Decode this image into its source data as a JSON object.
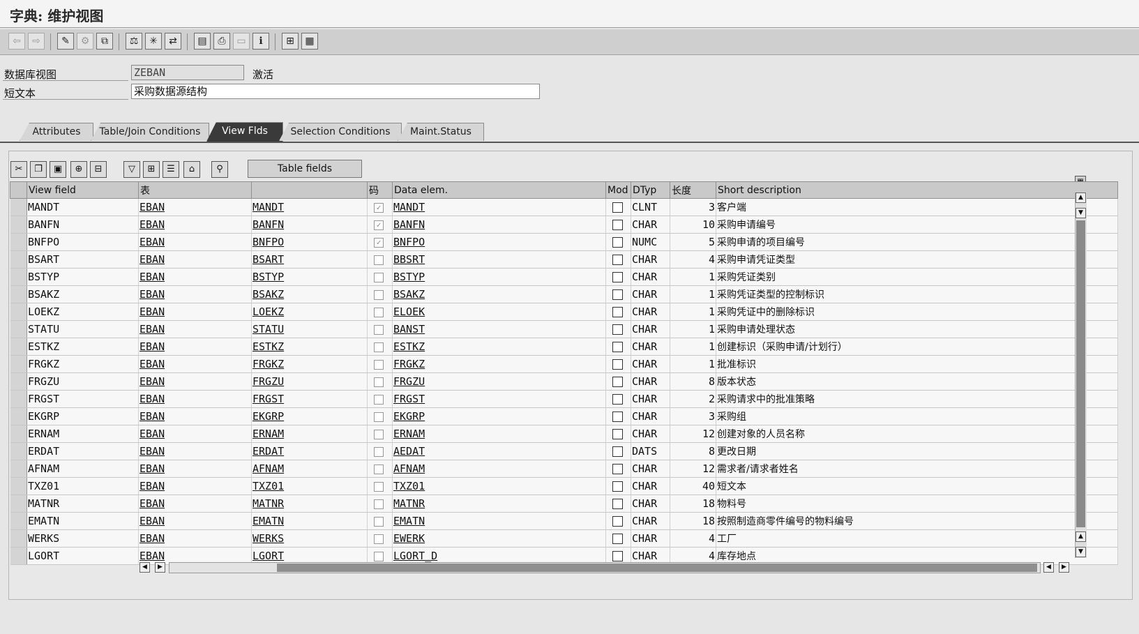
{
  "window": {
    "title": "字典: 维护视图"
  },
  "toolbar": {
    "icons": [
      "back-icon",
      "forward-icon",
      "edit-icon",
      "other-object-icon",
      "activate-icon",
      "check-icon",
      "test-icon",
      "where-used-icon",
      "display-object-list-icon",
      "navigation-window-icon",
      "print-icon",
      "info-icon",
      "hierarchy-icon",
      "table-grid-icon"
    ]
  },
  "header": {
    "view_label": "数据库视图",
    "view_value": "ZEBAN",
    "status": "激活",
    "short_text_label": "短文本",
    "short_text_value": "采购数据源结构"
  },
  "tabs": [
    {
      "label": "Attributes",
      "active": false
    },
    {
      "label": "Table/Join Conditions",
      "active": false
    },
    {
      "label": "View Flds",
      "active": true
    },
    {
      "label": "Selection Conditions",
      "active": false
    },
    {
      "label": "Maint.Status",
      "active": false
    }
  ],
  "panel": {
    "table_fields_label": "Table fields"
  },
  "grid": {
    "headers": [
      "View field",
      "表",
      "",
      "码",
      "Data elem.",
      "Mod",
      "DTyp",
      "长度",
      "Short description"
    ],
    "rows": [
      {
        "view_field": "MANDT",
        "table": "EBAN",
        "field": "MANDT",
        "key": true,
        "data_elem": "MANDT",
        "mod": false,
        "dtyp": "CLNT",
        "length": "3",
        "desc": "客户端"
      },
      {
        "view_field": "BANFN",
        "table": "EBAN",
        "field": "BANFN",
        "key": true,
        "data_elem": "BANFN",
        "mod": false,
        "dtyp": "CHAR",
        "length": "10",
        "desc": "采购申请编号"
      },
      {
        "view_field": "BNFPO",
        "table": "EBAN",
        "field": "BNFPO",
        "key": true,
        "data_elem": "BNFPO",
        "mod": false,
        "dtyp": "NUMC",
        "length": "5",
        "desc": "采购申请的项目编号"
      },
      {
        "view_field": "BSART",
        "table": "EBAN",
        "field": "BSART",
        "key": false,
        "data_elem": "BBSRT",
        "mod": false,
        "dtyp": "CHAR",
        "length": "4",
        "desc": "采购申请凭证类型"
      },
      {
        "view_field": "BSTYP",
        "table": "EBAN",
        "field": "BSTYP",
        "key": false,
        "data_elem": "BSTYP",
        "mod": false,
        "dtyp": "CHAR",
        "length": "1",
        "desc": "采购凭证类别"
      },
      {
        "view_field": "BSAKZ",
        "table": "EBAN",
        "field": "BSAKZ",
        "key": false,
        "data_elem": "BSAKZ",
        "mod": false,
        "dtyp": "CHAR",
        "length": "1",
        "desc": "采购凭证类型的控制标识"
      },
      {
        "view_field": "LOEKZ",
        "table": "EBAN",
        "field": "LOEKZ",
        "key": false,
        "data_elem": "ELOEK",
        "mod": false,
        "dtyp": "CHAR",
        "length": "1",
        "desc": "采购凭证中的删除标识"
      },
      {
        "view_field": "STATU",
        "table": "EBAN",
        "field": "STATU",
        "key": false,
        "data_elem": "BANST",
        "mod": false,
        "dtyp": "CHAR",
        "length": "1",
        "desc": "采购申请处理状态"
      },
      {
        "view_field": "ESTKZ",
        "table": "EBAN",
        "field": "ESTKZ",
        "key": false,
        "data_elem": "ESTKZ",
        "mod": false,
        "dtyp": "CHAR",
        "length": "1",
        "desc": "创建标识（采购申请/计划行）"
      },
      {
        "view_field": "FRGKZ",
        "table": "EBAN",
        "field": "FRGKZ",
        "key": false,
        "data_elem": "FRGKZ",
        "mod": false,
        "dtyp": "CHAR",
        "length": "1",
        "desc": "批准标识"
      },
      {
        "view_field": "FRGZU",
        "table": "EBAN",
        "field": "FRGZU",
        "key": false,
        "data_elem": "FRGZU",
        "mod": false,
        "dtyp": "CHAR",
        "length": "8",
        "desc": "版本状态"
      },
      {
        "view_field": "FRGST",
        "table": "EBAN",
        "field": "FRGST",
        "key": false,
        "data_elem": "FRGST",
        "mod": false,
        "dtyp": "CHAR",
        "length": "2",
        "desc": "采购请求中的批准策略"
      },
      {
        "view_field": "EKGRP",
        "table": "EBAN",
        "field": "EKGRP",
        "key": false,
        "data_elem": "EKGRP",
        "mod": false,
        "dtyp": "CHAR",
        "length": "3",
        "desc": "采购组"
      },
      {
        "view_field": "ERNAM",
        "table": "EBAN",
        "field": "ERNAM",
        "key": false,
        "data_elem": "ERNAM",
        "mod": false,
        "dtyp": "CHAR",
        "length": "12",
        "desc": "创建对象的人员名称"
      },
      {
        "view_field": "ERDAT",
        "table": "EBAN",
        "field": "ERDAT",
        "key": false,
        "data_elem": "AEDAT",
        "mod": false,
        "dtyp": "DATS",
        "length": "8",
        "desc": "更改日期"
      },
      {
        "view_field": "AFNAM",
        "table": "EBAN",
        "field": "AFNAM",
        "key": false,
        "data_elem": "AFNAM",
        "mod": false,
        "dtyp": "CHAR",
        "length": "12",
        "desc": "需求者/请求者姓名"
      },
      {
        "view_field": "TXZ01",
        "table": "EBAN",
        "field": "TXZ01",
        "key": false,
        "data_elem": "TXZ01",
        "mod": false,
        "dtyp": "CHAR",
        "length": "40",
        "desc": "短文本"
      },
      {
        "view_field": "MATNR",
        "table": "EBAN",
        "field": "MATNR",
        "key": false,
        "data_elem": "MATNR",
        "mod": false,
        "dtyp": "CHAR",
        "length": "18",
        "desc": "物料号"
      },
      {
        "view_field": "EMATN",
        "table": "EBAN",
        "field": "EMATN",
        "key": false,
        "data_elem": "EMATN",
        "mod": false,
        "dtyp": "CHAR",
        "length": "18",
        "desc": "按照制造商零件编号的物料编号"
      },
      {
        "view_field": "WERKS",
        "table": "EBAN",
        "field": "WERKS",
        "key": false,
        "data_elem": "EWERK",
        "mod": false,
        "dtyp": "CHAR",
        "length": "4",
        "desc": "工厂"
      },
      {
        "view_field": "LGORT",
        "table": "EBAN",
        "field": "LGORT",
        "key": false,
        "data_elem": "LGORT_D",
        "mod": false,
        "dtyp": "CHAR",
        "length": "4",
        "desc": "库存地点"
      }
    ]
  }
}
